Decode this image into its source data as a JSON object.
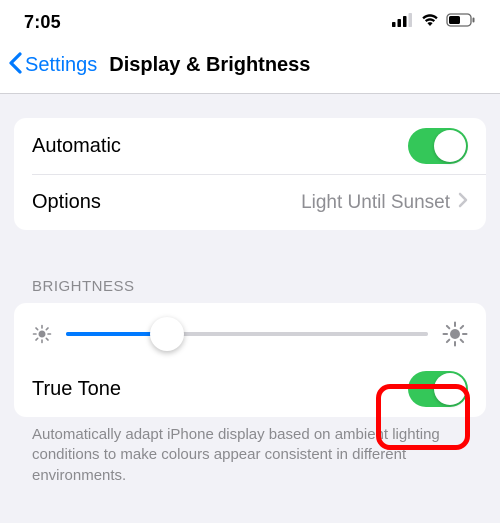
{
  "status": {
    "time": "7:05"
  },
  "nav": {
    "back_label": "Settings",
    "title": "Display & Brightness"
  },
  "group1": {
    "automatic_label": "Automatic",
    "automatic_on": true,
    "options_label": "Options",
    "options_value": "Light Until Sunset"
  },
  "brightness": {
    "header": "BRIGHTNESS",
    "slider_value_percent": 28,
    "true_tone_label": "True Tone",
    "true_tone_on": true,
    "footer": "Automatically adapt iPhone display based on ambient lighting conditions to make colours appear consistent in different environments."
  },
  "colors": {
    "accent": "#007aff",
    "toggle_on": "#34c759",
    "highlight": "#ff0000"
  }
}
